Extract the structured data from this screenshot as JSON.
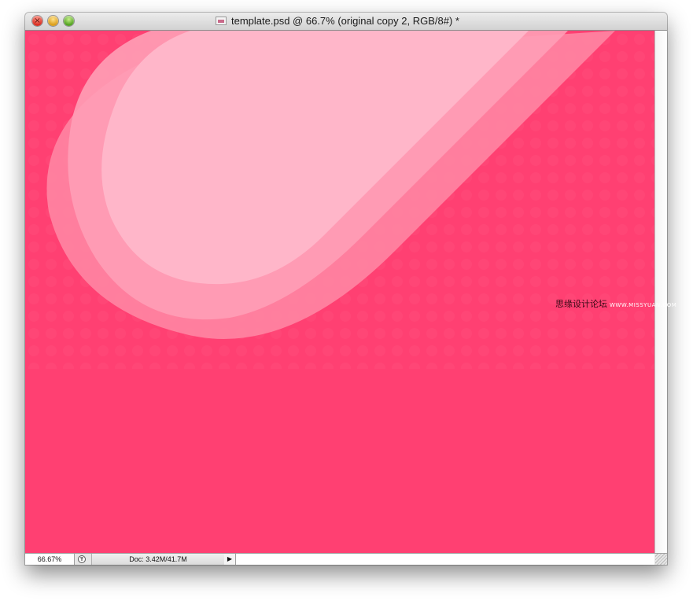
{
  "window": {
    "title": "template.psd @ 66.7% (original copy 2, RGB/8#) *"
  },
  "canvas": {
    "background_color": "#ff4072",
    "shape_colors": [
      "#ff8aa6",
      "#ff9fb6",
      "#ffb6c9"
    ]
  },
  "statusbar": {
    "zoom_level": "66.67%",
    "doc_size": "Doc: 3.42M/41.7M"
  },
  "watermark": {
    "brand": "思缘设计论坛",
    "site": "WWW.MISSYUAN.COM"
  },
  "icons": {
    "close": "close-icon",
    "minimize": "minimize-icon",
    "zoom": "zoom-icon",
    "document": "psd-document-icon",
    "status": "status-icon",
    "menu_arrow": "triangle-right-icon",
    "resize": "resize-grip-icon"
  }
}
